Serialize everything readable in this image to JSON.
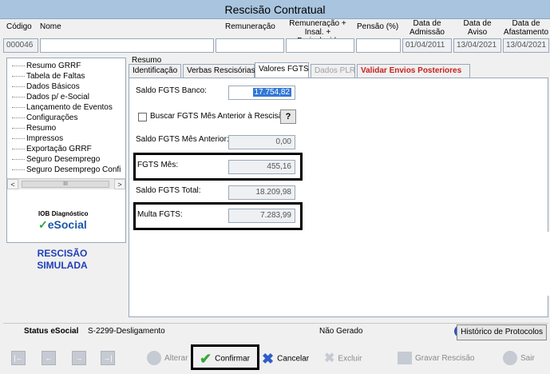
{
  "window": {
    "title": "Rescisão Contratual"
  },
  "header": {
    "labels": {
      "codigo": "Código",
      "nome": "Nome",
      "remuneracao": "Remuneração",
      "remuneracao_insal_l1": "Remuneração +",
      "remuneracao_insal_l2": "Insal. + Periculosid.",
      "pensao": "Pensão (%)",
      "admissao_l1": "Data de",
      "admissao_l2": "Admissão",
      "aviso_l1": "Data de",
      "aviso_l2": "Aviso",
      "afastamento_l1": "Data de",
      "afastamento_l2": "Afastamento"
    },
    "values": {
      "codigo": "000046",
      "nome": "",
      "remuneracao": "",
      "remuneracao_insal": "",
      "pensao": "",
      "admissao": "01/04/2011",
      "aviso": "13/04/2021",
      "afastamento": "13/04/2021"
    }
  },
  "sidebar": {
    "items": [
      "Resumo GRRF",
      "Tabela de Faltas",
      "Dados Básicos",
      "Dados p/ e-Social",
      "Lançamento de Eventos",
      "Configurações",
      "Resumo",
      "Impressos",
      "Exportação GRRF",
      "Seguro Desemprego",
      "Seguro Desemprego Confi"
    ],
    "scroll": {
      "left": "<",
      "thumb": "III",
      "right": ">"
    },
    "logo": {
      "brand": "IOB",
      "brand_sub": "Diagnóstico",
      "esocial": "eSocial"
    },
    "simulation_l1": "RESCISÃO",
    "simulation_l2": "SIMULADA"
  },
  "main": {
    "section_label": "Resumo",
    "tabs": [
      {
        "label": "Identificação",
        "state": "normal"
      },
      {
        "label": "Verbas Rescisórias",
        "state": "normal"
      },
      {
        "label": "Valores FGTS",
        "state": "active"
      },
      {
        "label": "Dados PLR",
        "state": "disabled"
      },
      {
        "label": "Validar Envios Posteriores",
        "state": "warning"
      }
    ],
    "fields": {
      "saldo_banco_label": "Saldo FGTS Banco:",
      "saldo_banco_value": "17.754,82",
      "buscar_label": "Buscar FGTS Mês Anterior à Rescisão",
      "buscar_button": "?",
      "saldo_mes_anterior_label": "Saldo FGTS Mês Anterior:",
      "saldo_mes_anterior_value": "0,00",
      "fgts_mes_label": "FGTS Mês:",
      "fgts_mes_value": "455,16",
      "saldo_total_label": "Saldo FGTS Total:",
      "saldo_total_value": "18.209,98",
      "multa_label": "Multa FGTS:",
      "multa_value": "7.283,99"
    }
  },
  "status_bar": {
    "label": "Status eSocial",
    "event": "S-2299-Desligamento",
    "state": "Não Gerado",
    "help": "?",
    "history_button": "Histórico de Protocolos"
  },
  "toolbar": {
    "nav": [
      "|←",
      "←",
      "→",
      "→|"
    ],
    "alterar": "Alterar",
    "confirmar": "Confirmar",
    "cancelar": "Cancelar",
    "excluir": "Excluir",
    "gravar": "Gravar Rescisão",
    "sair": "Sair"
  },
  "colors": {
    "accent": "#a9c4de",
    "warning": "#c8201c",
    "simulation": "#1f3fb8",
    "selection": "#3378d6"
  }
}
